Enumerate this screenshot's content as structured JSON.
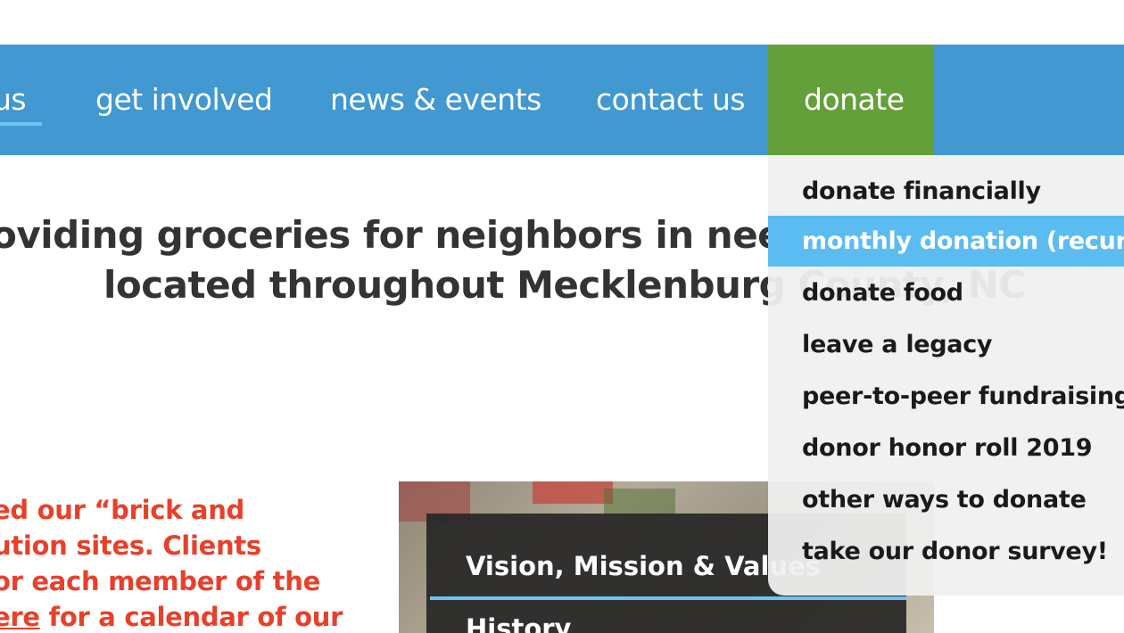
{
  "nav": {
    "about_label": "us",
    "get_involved_label": "get involved",
    "news_events_label": "news & events",
    "contact_label": "contact us",
    "donate_label": "donate"
  },
  "headline": {
    "line1": "oviding groceries for neighbors in need at",
    "line2": "located throughout Mecklenburg County, NC"
  },
  "intro_text": {
    "line1": "ed our “brick and",
    "line2": "ution sites. Clients",
    "line3": "or each member of the",
    "line4_link": "ere",
    "line4_rest": " for a calendar of our"
  },
  "about_submenu": {
    "items": [
      {
        "label": "Vision, Mission & Values"
      },
      {
        "label": "History"
      }
    ]
  },
  "donate_dropdown": {
    "items": [
      {
        "label": "donate financially"
      },
      {
        "label": "monthly donation (recurring)",
        "active": true
      },
      {
        "label": "donate food"
      },
      {
        "label": "leave a legacy"
      },
      {
        "label": "peer-to-peer fundraising"
      },
      {
        "label": "donor honor roll 2019"
      },
      {
        "label": "other ways to donate"
      },
      {
        "label": "take our donor survey!"
      }
    ]
  },
  "colors": {
    "nav_bg": "#4298d0",
    "donate_bg": "#63a03a",
    "active_item_bg": "#5bbcf2",
    "accent_underline": "#6cc4f3",
    "red_text": "#e8402a",
    "headline_text": "#333333"
  }
}
